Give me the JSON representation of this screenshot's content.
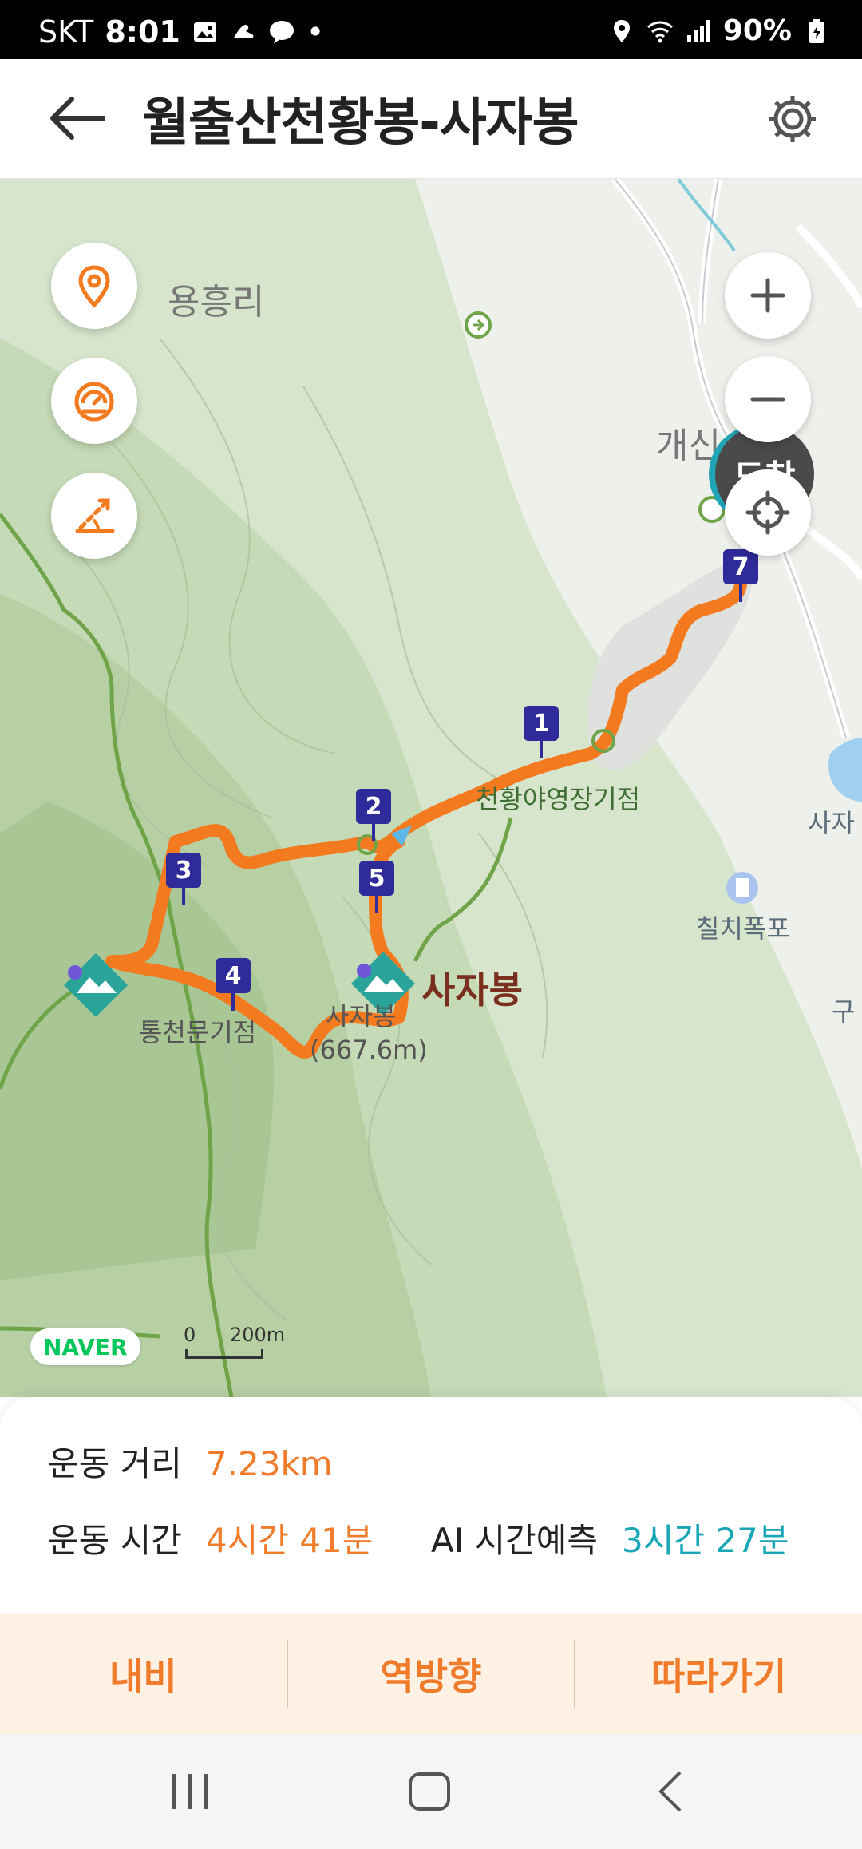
{
  "status": {
    "carrier": "SKT",
    "time": "8:01",
    "battery": "90%"
  },
  "header": {
    "title": "월출산천황봉-사자봉"
  },
  "map": {
    "places": {
      "village1": "용흥리",
      "village2": "개신",
      "camp": "천황야영장기점",
      "waterfall": "칠치폭포",
      "gate": "통천문기점",
      "peak_main": "사자봉",
      "peak_small": "사자봉",
      "peak_elev": "(667.6m)",
      "edge1": "사자",
      "edge2": "구"
    },
    "waypoints": [
      "1",
      "2",
      "3",
      "4",
      "5",
      "7"
    ],
    "arrival_badge": "도착",
    "provider": "NAVER",
    "scale_min": "0",
    "scale_max": "200m"
  },
  "info": {
    "distance_label": "운동 거리",
    "distance_value": "7.23km",
    "time_label": "운동 시간",
    "time_value": "4시간 41분",
    "ai_label": "AI 시간예측",
    "ai_value": "3시간 27분"
  },
  "actions": {
    "navi": "내비",
    "reverse": "역방향",
    "follow": "따라가기"
  },
  "colors": {
    "route": "#f47a20",
    "accent": "#f07b2a",
    "ai": "#19a7b8",
    "waypoint": "#2f2b9a"
  }
}
